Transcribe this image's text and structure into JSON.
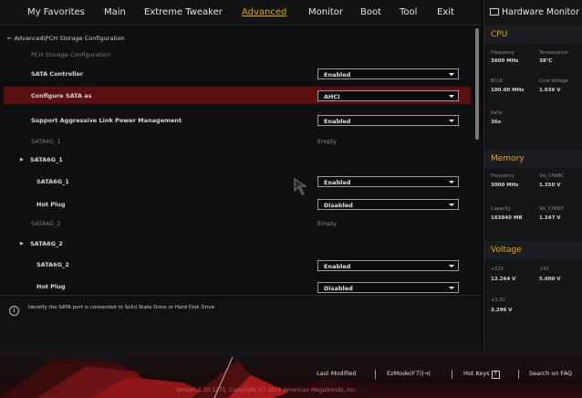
{
  "nav": {
    "tabs": [
      "My Favorites",
      "Main",
      "Extreme Tweaker",
      "Advanced",
      "Monitor",
      "Boot",
      "Tool",
      "Exit"
    ],
    "active": "Advanced"
  },
  "breadcrumb": "← Advanced\\PCH Storage Configuration",
  "section_title": "PCH Storage Configuration",
  "settings": {
    "sata_controller": {
      "label": "SATA Controller",
      "value": "Enabled"
    },
    "configure_sata": {
      "label": "Configure SATA as",
      "value": "AHCI"
    },
    "alpm": {
      "label": "Support Aggressive Link Power Management",
      "value": "Enabled"
    },
    "sata6g1_status": {
      "label": "SATA6G_1",
      "value": "Empty"
    },
    "sata6g1_group": {
      "label": "SATA6G_1"
    },
    "sata6g1_enable": {
      "label": "SATA6G_1",
      "value": "Enabled"
    },
    "hotplug1": {
      "label": "Hot Plug",
      "value": "Disabled"
    },
    "sata6g2_status": {
      "label": "SATA6G_2",
      "value": "Empty"
    },
    "sata6g2_group": {
      "label": "SATA6G_2"
    },
    "sata6g2_enable": {
      "label": "SATA6G_2",
      "value": "Enabled"
    },
    "hotplug2": {
      "label": "Hot Plug",
      "value": "Disabled"
    }
  },
  "help_text": "Identify the SATA port is connected to Solid State Drive or Hard Disk Drive",
  "help_icon": "info-icon",
  "hw_monitor": {
    "title": "Hardware Monitor",
    "cpu": {
      "heading": "CPU",
      "frequency_label": "Frequency",
      "frequency": "3600 MHz",
      "temperature_label": "Temperature",
      "temperature": "38°C",
      "bclk_label": "BCLK",
      "bclk": "100.00 MHz",
      "core_voltage_label": "Core Voltage",
      "core_voltage": "1.036 V",
      "ratio_label": "Ratio",
      "ratio": "36x"
    },
    "memory": {
      "heading": "Memory",
      "frequency_label": "Frequency",
      "frequency": "3000 MHz",
      "vol_a_label": "Vol_CHABC",
      "vol_a": "1.350 V",
      "capacity_label": "Capacity",
      "capacity": "163840 MB",
      "vol_b_label": "Vol_CHDEF",
      "vol_b": "1.347 V"
    },
    "voltage": {
      "heading": "Voltage",
      "v12_label": "+12V",
      "v12": "12.264 V",
      "v5_label": "+5V",
      "v5": "5.000 V",
      "v33_label": "+3.3V",
      "v33": "3.296 V"
    }
  },
  "footer": {
    "last_modified": "Last Modified",
    "ezmode": "EzMode(F7)|→|",
    "hotkeys": "Hot Keys",
    "hotkeys_key": "?",
    "search": "Search on FAQ",
    "version": "Version 2.20.1271. Copyright (C) 2019 American Megatrends, Inc."
  },
  "colors": {
    "accent": "#e0a800",
    "highlight_row": "#5a0f10",
    "brand_red": "#c0181c"
  }
}
